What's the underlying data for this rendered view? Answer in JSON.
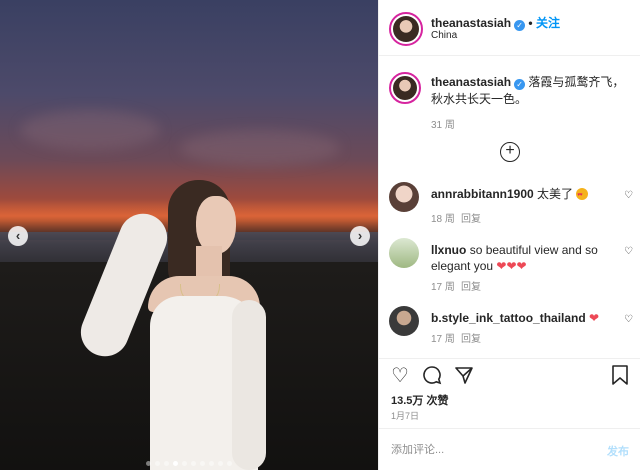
{
  "post": {
    "username": "theanastasiah",
    "follow_label": "关注",
    "location": "China",
    "caption": "落霞与孤鹜齐飞，秋水共长天一色。",
    "caption_age": "31 周",
    "likes": "13.5万 次赞",
    "date": "1月7日"
  },
  "carousel": {
    "prev_icon": "chevron-left-icon",
    "next_icon": "chevron-right-icon",
    "dot_count": 10,
    "active_index": 3
  },
  "comments": [
    {
      "user": "annrabbitann1900",
      "text": "太美了",
      "emoji": "smiling-face-with-heart-eyes",
      "age": "18 周",
      "reply": "回复"
    },
    {
      "user": "llxnuo",
      "text": "so beautiful view and so elegant you",
      "hearts": "❤❤❤",
      "age": "17 周",
      "reply": "回复"
    },
    {
      "user": "b.style_ink_tattoo_thailand",
      "text": "",
      "hearts": "❤",
      "age": "17 周",
      "reply": "回复"
    }
  ],
  "add_comment": {
    "placeholder": "添加评论...",
    "post_label": "发布"
  },
  "colors": {
    "link_blue": "#0095f6",
    "verified_blue": "#3897f0",
    "heart_red": "#ed4956",
    "post_disabled": "#b2dffc"
  }
}
